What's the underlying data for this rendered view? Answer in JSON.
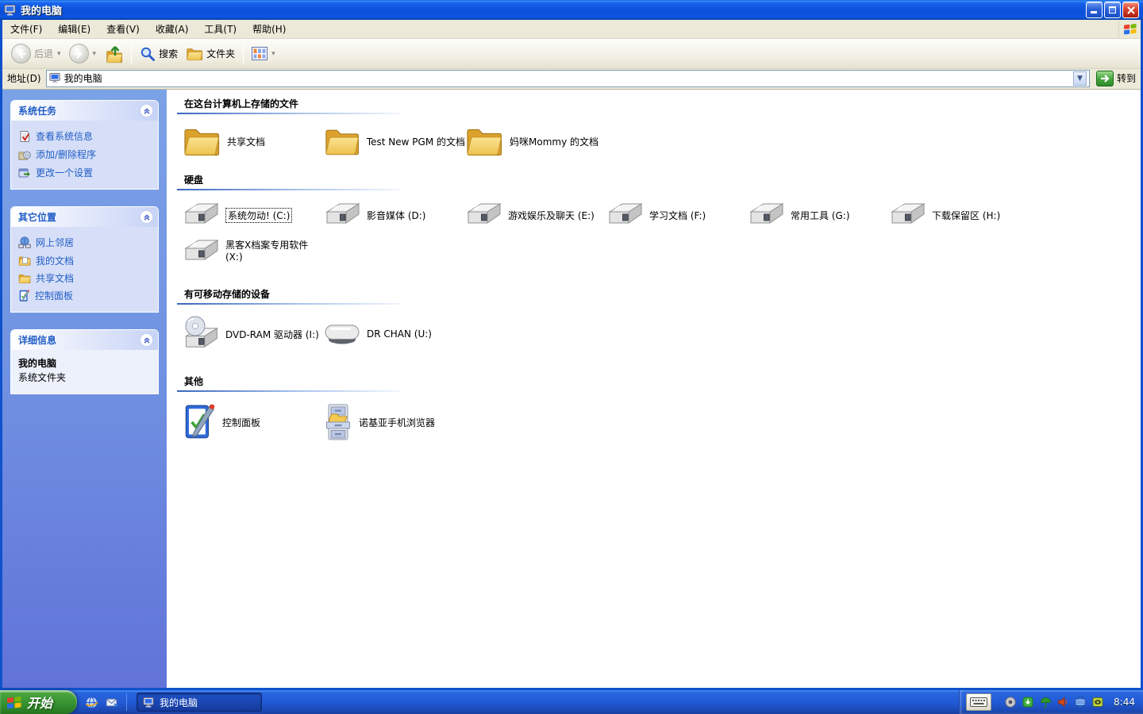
{
  "window": {
    "title": "我的电脑"
  },
  "menubar": {
    "items": [
      "文件(F)",
      "编辑(E)",
      "查看(V)",
      "收藏(A)",
      "工具(T)",
      "帮助(H)"
    ]
  },
  "toolbar": {
    "buttons": [
      {
        "label": "后退",
        "icon": "back-icon",
        "enabled": false
      },
      {
        "label": "",
        "icon": "forward-icon",
        "enabled": false
      },
      {
        "label": "",
        "icon": "up-icon",
        "enabled": true
      },
      {
        "label": "搜索",
        "icon": "search-icon",
        "enabled": true
      },
      {
        "label": "文件夹",
        "icon": "folders-icon",
        "enabled": true
      },
      {
        "label": "",
        "icon": "views-icon",
        "enabled": true
      }
    ]
  },
  "addressbar": {
    "label": "地址(D)",
    "value": "我的电脑",
    "go": "转到"
  },
  "sidebar": {
    "system_tasks": {
      "title": "系统任务",
      "items": [
        {
          "icon": "system-info-icon",
          "label": "查看系统信息"
        },
        {
          "icon": "add-remove-programs-icon",
          "label": "添加/删除程序"
        },
        {
          "icon": "change-setting-icon",
          "label": "更改一个设置"
        }
      ]
    },
    "other_places": {
      "title": "其它位置",
      "items": [
        {
          "icon": "network-places-icon",
          "label": "网上邻居"
        },
        {
          "icon": "my-documents-icon",
          "label": "我的文档"
        },
        {
          "icon": "shared-documents-icon",
          "label": "共享文档"
        },
        {
          "icon": "control-panel-icon",
          "label": "控制面板"
        }
      ]
    },
    "details": {
      "title": "详细信息",
      "name": "我的电脑",
      "type": "系统文件夹"
    }
  },
  "main": {
    "files": {
      "title": "在这台计算机上存储的文件",
      "items": [
        {
          "icon": "folder-icon",
          "label": "共享文档"
        },
        {
          "icon": "folder-icon",
          "label": "Test New PGM 的文档"
        },
        {
          "icon": "folder-icon",
          "label": "妈咪Mommy 的文档"
        }
      ]
    },
    "drives": {
      "title": "硬盘",
      "items": [
        {
          "icon": "hard-drive-icon",
          "label": "系统勿动! (C:)",
          "focused": true
        },
        {
          "icon": "hard-drive-icon",
          "label": "影音媒体 (D:)"
        },
        {
          "icon": "hard-drive-icon",
          "label": "游戏娱乐及聊天 (E:)"
        },
        {
          "icon": "hard-drive-icon",
          "label": "学习文档 (F:)"
        },
        {
          "icon": "hard-drive-icon",
          "label": "常用工具 (G:)"
        },
        {
          "icon": "hard-drive-icon",
          "label": "下载保留区 (H:)"
        },
        {
          "icon": "hard-drive-icon",
          "label": "黑客X档案专用软件 (X:)"
        }
      ]
    },
    "removable": {
      "title": "有可移动存储的设备",
      "items": [
        {
          "icon": "dvd-ram-drive-icon",
          "label": "DVD-RAM 驱动器 (I:)"
        },
        {
          "icon": "removable-drive-icon",
          "label": "DR CHAN (U:)"
        }
      ]
    },
    "other": {
      "title": "其他",
      "items": [
        {
          "icon": "control-panel-icon",
          "label": "控制面板"
        },
        {
          "icon": "file-cabinet-icon",
          "label": "诺基亚手机浏览器"
        }
      ]
    }
  },
  "taskbar": {
    "start": "开始",
    "tasks": [
      {
        "icon": "my-computer-icon",
        "label": "我的电脑",
        "active": true
      }
    ],
    "tray": {
      "clock": "8:44"
    }
  },
  "colors": {
    "titlebar_blue": "#0d53dd",
    "taskbar_blue": "#2159d2",
    "start_green": "#379331",
    "link_blue": "#215dc6",
    "panel_body": "#d6dff7",
    "sidebar_top": "#7ba2e7",
    "sidebar_bottom": "#6173d8"
  }
}
